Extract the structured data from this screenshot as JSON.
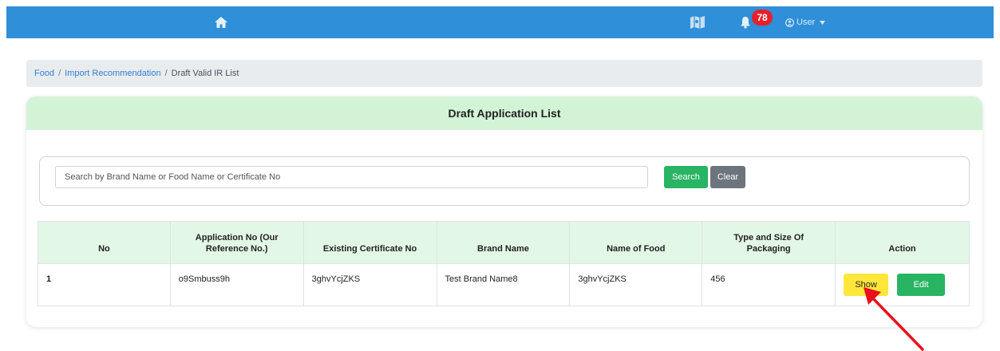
{
  "navbar": {
    "home_icon": "home-icon",
    "map_icon": "map-icon",
    "bell_icon": "bell-icon",
    "notification_count": "78",
    "user_label": "User",
    "colors": {
      "bar": "#2f8fd8",
      "badge": "#e8202a"
    }
  },
  "breadcrumb": {
    "items": [
      "Food",
      "Import Recommendation",
      "Draft Valid IR List"
    ],
    "separator": "/"
  },
  "card": {
    "title": "Draft Application List",
    "header_color": "#d3f3d7"
  },
  "search": {
    "placeholder": "Search by Brand Name or Food Name or Certificate No",
    "value": "",
    "search_label": "Search",
    "clear_label": "Clear"
  },
  "table": {
    "headers": [
      "No",
      "Application No (Our Reference No.)",
      "Existing Certificate No",
      "Brand Name",
      "Name of Food",
      "Type and Size Of Packaging",
      "Action"
    ],
    "rows": [
      {
        "no": "1",
        "application_no": "o9Smbuss9h",
        "certificate_no": "3ghvYcjZKS",
        "brand_name": "Test Brand Name8",
        "food_name": "3ghvYcjZKS",
        "packaging": "456",
        "show_label": "Show",
        "edit_label": "Edit"
      }
    ]
  },
  "annotation": {
    "arrow_color": "#e8101a",
    "arrow_target": "show-button"
  }
}
